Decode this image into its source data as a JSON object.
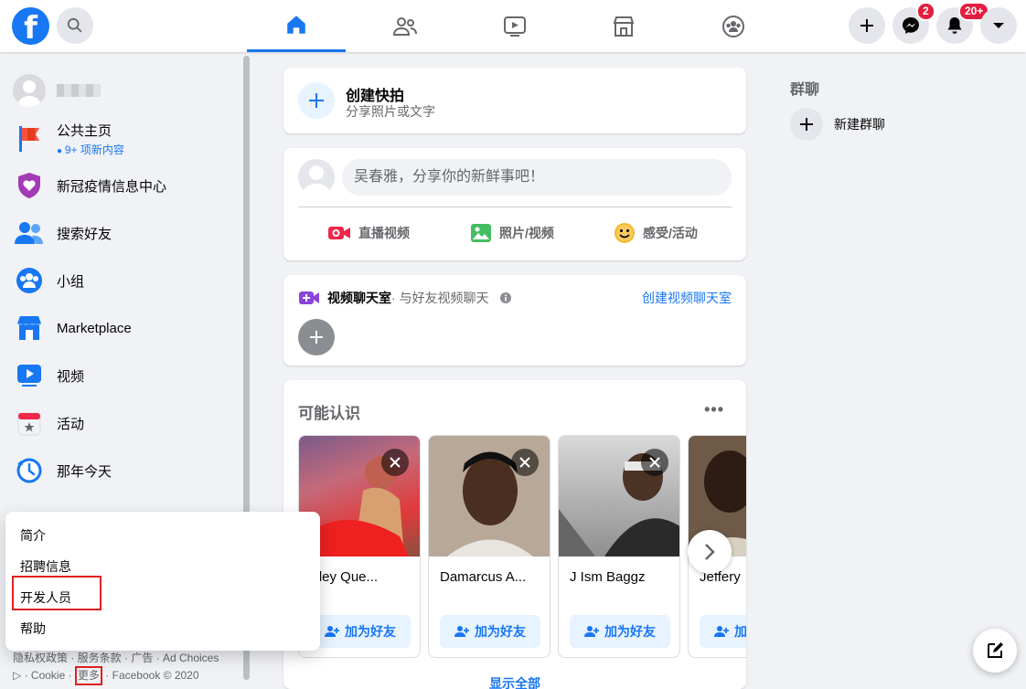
{
  "header": {
    "logo_letter": "f",
    "messenger_badge": "2",
    "notification_badge": "20+"
  },
  "sidebar": {
    "items": [
      {
        "label": "公共主页",
        "sub": "9+ 项新内容"
      },
      {
        "label": "新冠疫情信息中心"
      },
      {
        "label": "搜索好友"
      },
      {
        "label": "小组"
      },
      {
        "label": "Marketplace"
      },
      {
        "label": "视频"
      },
      {
        "label": "活动"
      },
      {
        "label": "那年今天"
      }
    ],
    "footer_line1": "隐私权政策 · 服务条款 · 广告 · Ad Choices",
    "footer_cookie": "· Cookie ·",
    "footer_more": "更多",
    "footer_copyright": "· Facebook © 2020"
  },
  "popup": {
    "items": [
      "简介",
      "招聘信息",
      "开发人员",
      "帮助"
    ]
  },
  "stories": {
    "title": "创建快拍",
    "subtitle": "分享照片或文字"
  },
  "composer": {
    "placeholder": "吴春雅，分享你的新鲜事吧！",
    "actions": [
      "直播视频",
      "照片/视频",
      "感受/活动"
    ]
  },
  "rooms": {
    "title": "视频聊天室",
    "subtitle": " · 与好友视频聊天",
    "create_link": "创建视频聊天室"
  },
  "pymk": {
    "title": "可能认识",
    "people": [
      {
        "name": "Marley Que..."
      },
      {
        "name": "Damarcus A..."
      },
      {
        "name": "J Ism Baggz"
      },
      {
        "name": "Jeffery"
      }
    ],
    "add_label": "加为好友",
    "see_all": "显示全部"
  },
  "right": {
    "group_chat_title": "群聊",
    "new_group": "新建群聊"
  },
  "colors": {
    "brand": "#1877f2",
    "badge": "#e41e3f",
    "highlight": "#e02020"
  }
}
